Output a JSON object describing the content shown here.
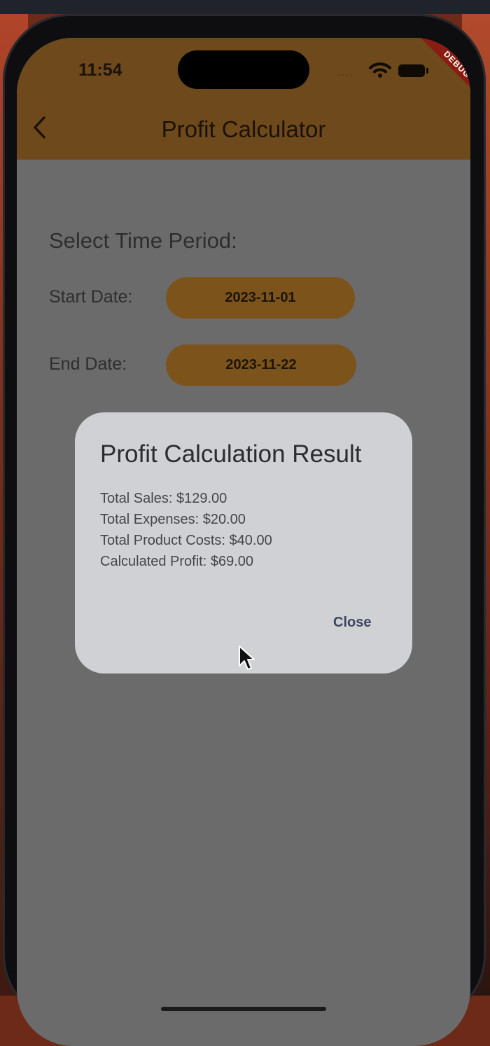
{
  "status_bar": {
    "time": "11:54",
    "signal": "····"
  },
  "debug_banner": "DEBUG",
  "app_bar": {
    "title": "Profit Calculator"
  },
  "content": {
    "section_title": "Select Time Period:",
    "start_date": {
      "label": "Start Date:",
      "value": "2023-11-01"
    },
    "end_date": {
      "label": "End Date:",
      "value": "2023-11-22"
    }
  },
  "dialog": {
    "title": "Profit Calculation Result",
    "lines": [
      "Total Sales: $129.00",
      "Total Expenses: $20.00",
      "Total Product Costs: $40.00",
      "Calculated Profit: $69.00"
    ],
    "close_label": "Close"
  },
  "colors": {
    "app_bar": "#6e491b",
    "date_button": "#7b531b",
    "scrim_background": "#6b6b6b",
    "dialog_background": "#d0d1d4",
    "debug_ribbon": "#8b1c12"
  }
}
